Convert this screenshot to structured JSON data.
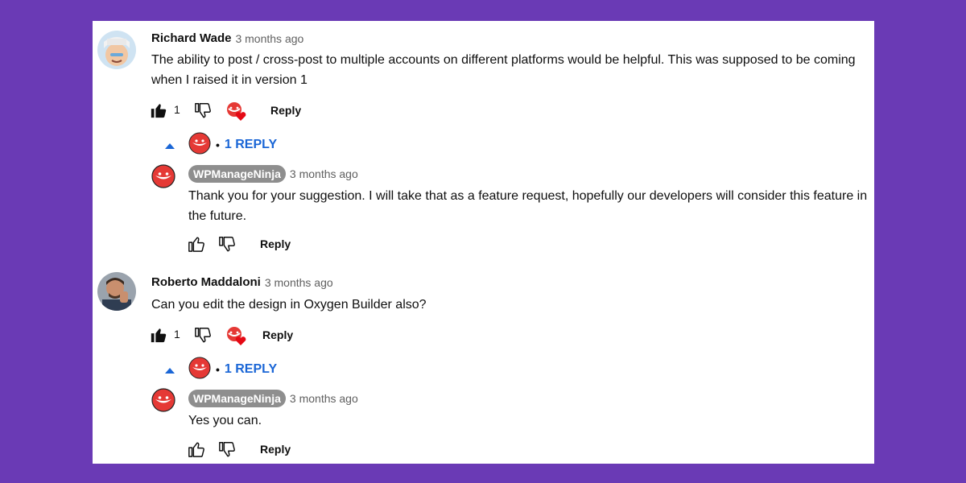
{
  "colors": {
    "background": "#6a3ab5",
    "panel": "#ffffff",
    "link_blue": "#1a66d6",
    "ninja_red": "#e53935",
    "chip_gray": "#8e8e8e"
  },
  "comments": [
    {
      "author": "Richard Wade",
      "time": "3 months ago",
      "text": "The ability to post / cross-post to multiple accounts on different platforms would be helpful. This was supposed to be coming when I raised it in version 1",
      "likes": "1",
      "reply_label": "Reply",
      "replies_toggle": "1 REPLY",
      "replies_dot": "•",
      "reply": {
        "author": "WPManageNinja",
        "time": "3 months ago",
        "text": "Thank you for your suggestion. I will take that as a feature request, hopefully our developers will consider this feature in the future.",
        "reply_label": "Reply"
      }
    },
    {
      "author": "Roberto Maddaloni",
      "time": "3 months ago",
      "text": "Can you edit the design in Oxygen Builder also?",
      "likes": "1",
      "reply_label": "Reply",
      "replies_toggle": "1 REPLY",
      "replies_dot": "•",
      "reply": {
        "author": "WPManageNinja",
        "time": "3 months ago",
        "text": "Yes you can.",
        "reply_label": "Reply"
      }
    }
  ]
}
